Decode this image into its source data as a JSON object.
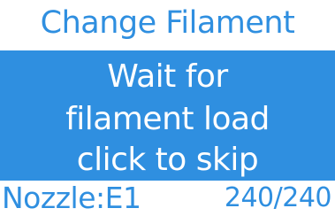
{
  "header": {
    "title": "Change Filament"
  },
  "message": {
    "lines": [
      "Wait for",
      "filament load",
      "click to skip"
    ]
  },
  "status": {
    "nozzle_label": "Nozzle:E1",
    "temperature": "240/240"
  },
  "colors": {
    "accent": "#2f8fe0",
    "background": "#ffffff",
    "panel_text": "#ffffff"
  }
}
